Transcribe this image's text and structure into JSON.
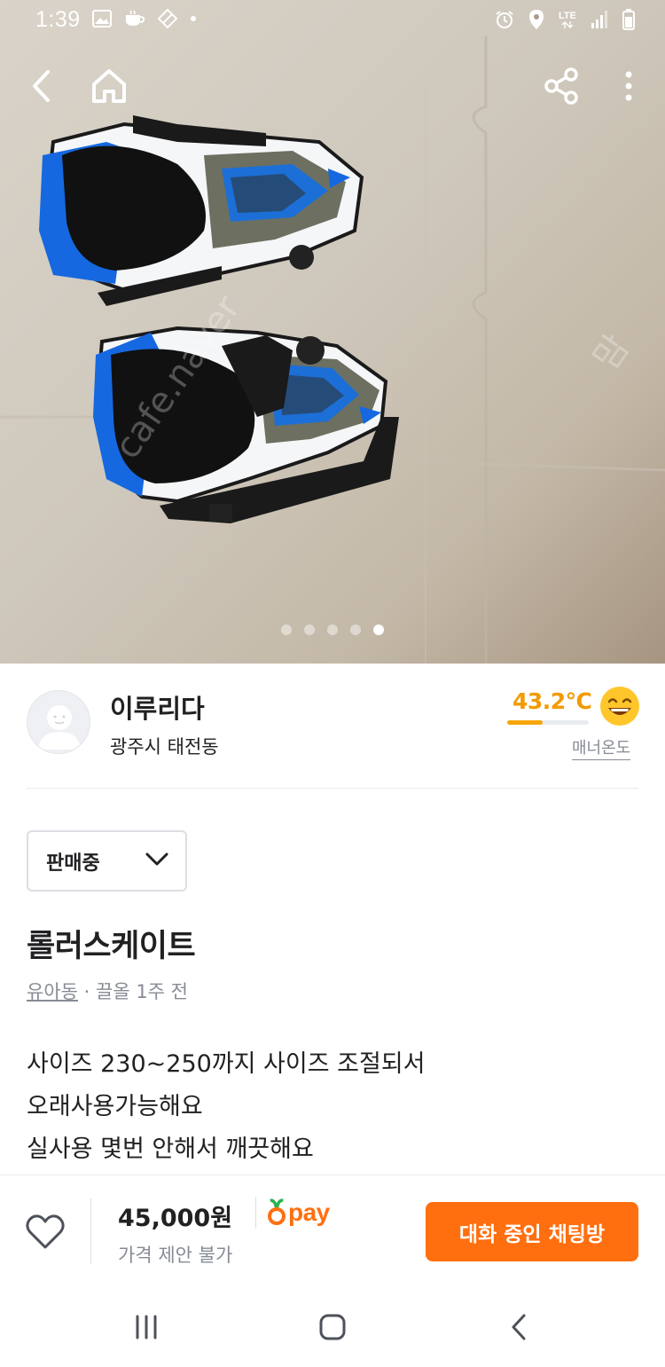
{
  "status_bar": {
    "time": "1:39",
    "network": "LTE",
    "icons": [
      "gallery-icon",
      "cafe-icon",
      "data-saver-icon",
      "alarm-icon",
      "location-icon",
      "signal-icon",
      "battery-icon"
    ]
  },
  "header": {
    "back_icon": "chevron-left-icon",
    "home_icon": "home-icon",
    "share_icon": "share-icon",
    "more_icon": "more-vertical-icon"
  },
  "carousel": {
    "count": 5,
    "active_index": 4
  },
  "seller": {
    "name": "이루리다",
    "location": "광주시 태전동",
    "temperature": "43.2℃",
    "temperature_level": 0.43,
    "manner_label": "매너온도"
  },
  "status_select": {
    "value": "판매중"
  },
  "listing": {
    "title": "롤러스케이트",
    "category": "유아동",
    "meta_rest": "· 끌올 1주 전",
    "description": [
      "사이즈 230~250까지 사이즈 조절되서",
      "오래사용가능해요",
      "실사용 몇번 안해서 깨끗해요"
    ]
  },
  "bottom_bar": {
    "price": "45,000원",
    "pay_label": "pay",
    "negotiation": "가격 제안 불가",
    "chat_button": "대화 중인 채팅방"
  },
  "colors": {
    "accent": "#ff6f0f",
    "temperature": "#f39a00",
    "text_primary": "#212124",
    "text_secondary": "#868b94"
  }
}
